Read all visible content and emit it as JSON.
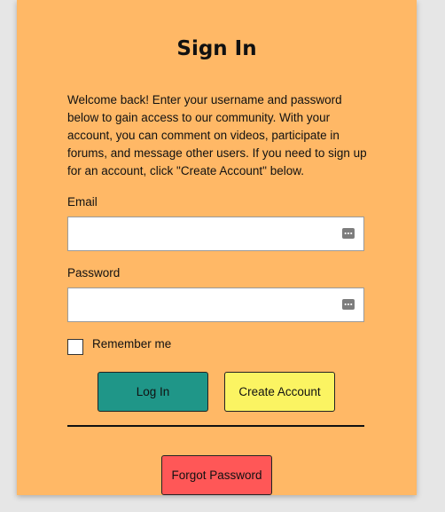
{
  "signin": {
    "title": "Sign In",
    "intro": "Welcome back! Enter your username and password below to gain access to our community. With your account, you can comment on videos, participate in forums, and message other users. If you need to sign up for an account, click \"Create Account\" below.",
    "email_label": "Email",
    "email_value": "",
    "password_label": "Password",
    "password_value": "",
    "remember_label": "Remember me",
    "remember_checked": false,
    "login_label": "Log In",
    "create_label": "Create Account",
    "forgot_label": "Forgot Password"
  },
  "colors": {
    "page_background": "#e6e6e6",
    "card_background": "#ffb866",
    "login_button": "#1f9688",
    "create_button": "#fbf462",
    "forgot_button": "#ff5757"
  },
  "icons": {
    "email_field_icon": "password-manager-key-icon",
    "password_field_icon": "password-manager-key-icon"
  }
}
